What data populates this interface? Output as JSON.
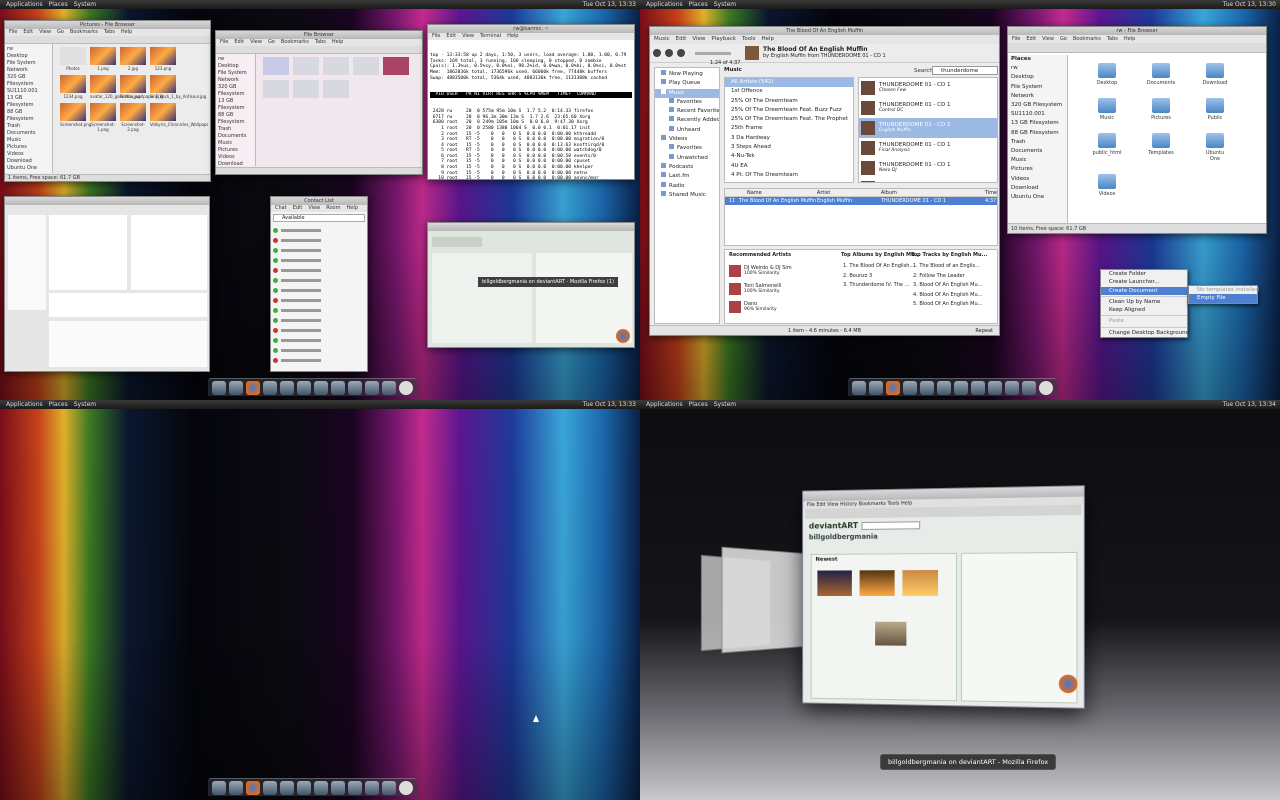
{
  "panel": {
    "applications": "Applications",
    "places": "Places",
    "system": "System",
    "clock_q1": "Tue Oct 13, 13:33",
    "clock_q2": "Tue Oct 13, 13:30",
    "clock_q3": "Tue Oct 13, 13:33",
    "clock_q4": "Tue Oct 13, 13:34"
  },
  "q1": {
    "pictures_title": "Pictures - File Browser",
    "pictures_files": [
      "Photos",
      "1.png",
      "2.jpg",
      "123.png",
      "1234.png",
      "avatar_120_galactica.jpg",
      "Firefox_wallpaper.png",
      "GnT_Pack_1_by_Antisoul.jpg",
      "Screenshot.png",
      "Screenshot-1.png",
      "Screenshot-2.png",
      "Valkyria_Chronicles_Wallpaper_by..."
    ],
    "pictures_status": "1 items, Free space: 61.7 GB",
    "term_title": "rw@karmic: ~",
    "term_menu": [
      "File",
      "Edit",
      "View",
      "Terminal",
      "Help"
    ],
    "term_lines": [
      "top - 13:33:58 up 2 days, 1:50, 3 users, load average: 1.00, 1.00, 0.79",
      "Tasks: 169 total, 3 running, 166 sleeping, 0 stopped, 0 zombie",
      "Cpu(s): 1.3%us, 0.5%sy, 0.0%ni, 98.2%id, 0.0%wa, 0.0%hi, 0.0%si, 0.0%st",
      "Mem:  1862836k total, 1736596k used, 66060k free, 77448k buffers",
      "Swap: 4883500k total, 5364k used, 4883136k free, 1131308k cached"
    ],
    "term_header": "  PID USER   PR NI VIRT RES SHR S %CPU %MEM   TIME+  COMMAND",
    "term_procs": [
      " 2428 rw     20  0 575m 95m 10m S  1.7 5.2  0:14.33 firefox",
      " 6717 rw     20  0 96.3m 30m 13m S  1.7 2.6  23:65.60 Xorg",
      " 6300 root   20  0 249m 105m 10m S  0.0 6.0  9:47.30 Xorg",
      "    1 root   20  0 2580 1380 1064 S  0.0 0.1  0:01.17 init",
      "    2 root   15 -5    0   0   0 S  0.0 0.0  0:00.00 kthreadd",
      "    3 root   RT -5    0   0   0 S  0.0 0.0  0:00.00 migration/0",
      "    4 root   15 -5    0   0   0 S  0.0 0.0  0:13.63 ksoftirqd/0",
      "    5 root   RT -5    0   0   0 S  0.0 0.0  0:00.00 watchdog/0",
      "    6 root   15 -5    0   0   0 S  0.0 0.0  0:00.58 events/0",
      "    7 root   15 -5    0   0   0 S  0.0 0.0  0:00.00 cpuset",
      "    8 root   15 -5    0   0   0 S  0.0 0.0  0:00.00 khelper",
      "    9 root   15 -5    0   0   0 S  0.0 0.0  0:00.00 netns",
      "   10 root   15 -5    0   0   0 S  0.0 0.0  0:00.00 async/mgr",
      "   11 root   15 -5    0   0   0 S  0.0 0.0  0:00.00 kintegrityd/0",
      "   12 root   15 -5    0   0   0 S  0.0 0.0  0:00.77 kblockd/0",
      "   13 root   15 -5    0   0   0 S  0.0 0.0  2:02.72 kacpid",
      "   14 root   15 -5    0   0   0 S  0.0 0.0  0:04.56 kacpi_notify"
    ],
    "contacts_title": "Contact List",
    "contacts_status": "Available",
    "firefox_tooltip": "billgoldbergmania on deviantART - Mozilla Firefox (1)"
  },
  "q2": {
    "rb_title": "The Blood Of An English Muffin",
    "rb_menu": [
      "Music",
      "Edit",
      "View",
      "Playback",
      "Tools",
      "Help"
    ],
    "rb_now_title": "The Blood Of An English Muffin",
    "rb_now_by": "by English Muffin from THUNDERDOME 01 - CD 1",
    "rb_time": "1:24 of 4:37",
    "rb_search_label": "Search:",
    "rb_search_value": "thunderdome",
    "rb_sources": [
      "Now Playing",
      "Play Queue",
      "Music",
      "Favorites",
      "Recent Favorites",
      "Recently Added",
      "Unheard",
      "Videos",
      "Favorites",
      "Unwatched",
      "Podcasts",
      "Last.fm",
      "Radio",
      "Shared Music"
    ],
    "rb_artists_header": "Music",
    "rb_artists": [
      "All Artists (542)",
      "1st Offence",
      "25% Of The Dreemteam",
      "25% Of The Dreemteam Feat. Buzz Fuzz",
      "25% Of The Dreemteam Feat. The Prophet",
      "25th Frame",
      "3 Da Hardway",
      "3 Steps Ahead",
      "4-Nu-Tek",
      "4U EA",
      "4 Pt. Of The Dreemteam"
    ],
    "rb_albums": [
      {
        "title": "THUNDERDOME 01 - CD 1",
        "artist": "Chosen Few"
      },
      {
        "title": "THUNDERDOME 01 - CD 1",
        "artist": "Control DC"
      },
      {
        "title": "THUNDERDOME 01 - CD 1",
        "artist": "English Muffin"
      },
      {
        "title": "THUNDERDOME 01 - CD 1",
        "artist": "Final Analysis"
      },
      {
        "title": "THUNDERDOME 01 - CD 1",
        "artist": "Neko DJ"
      },
      {
        "title": "THUNDERDOME 01 - CD 1",
        "artist": ""
      }
    ],
    "rb_cols": [
      "Name",
      "Artist",
      "Album",
      "Time"
    ],
    "rb_track": {
      "num": "11",
      "name": "The Blood Of An English Muffin",
      "artist": "English Muffin",
      "album": "THUNDERDOME 01 - CD 1",
      "time": "4:37"
    },
    "rb_rec_artists_h": "Recommended Artists",
    "rb_rec_artists": [
      {
        "name": "DJ Weirdo & DJ Sim",
        "sim": "100% Similarity"
      },
      {
        "name": "Toni Salmonelli",
        "sim": "100% Similarity"
      },
      {
        "name": "Dano",
        "sim": "96% Similarity"
      }
    ],
    "rb_top_albums_h": "Top Albums by English Mu...",
    "rb_top_albums": [
      "1. The Blood Of An English...",
      "2. Bounzz 3",
      "3. Thunderdome IV: The ..."
    ],
    "rb_top_tracks_h": "Top Tracks by English Mu...",
    "rb_top_tracks": [
      "1. The Blood of an Englis...",
      "2. Follow The Leader",
      "3. Blood Of An English Mu...",
      "4. Blood Of An English Mu...",
      "5. Blood Of An English Mu..."
    ],
    "rb_status": "1 item - 4.6 minutes - 6.4 MB",
    "rb_repeat": "Repeat",
    "fb_title": "rw - File Browser",
    "fb_menu": [
      "File",
      "Edit",
      "View",
      "Go",
      "Bookmarks",
      "Tabs",
      "Help"
    ],
    "fb_places_h": "Places",
    "fb_places": [
      "rw",
      "Desktop",
      "File System",
      "Network",
      "320 GB Filesystem",
      "SU1110.001",
      "13 GB Filesystem",
      "88 GB Filesystem",
      "Trash",
      "Documents",
      "Music",
      "Pictures",
      "Videos",
      "Download",
      "Ubuntu One"
    ],
    "fb_items": [
      "Desktop",
      "Documents",
      "Download",
      "Music",
      "Pictures",
      "Public",
      "public_html",
      "Templates",
      "Ubuntu One",
      "Videos"
    ],
    "fb_status": "10 items, Free space: 61.7 GB",
    "ctx_items": [
      "Create Folder",
      "Create Launcher...",
      "Create Document",
      "Clean Up by Name",
      "Keep Aligned",
      "Paste",
      "Change Desktop Background"
    ],
    "ctx_sub": [
      "No templates installed",
      "Empty File"
    ]
  },
  "q4": {
    "caption": "billgoldbergmania on deviantART - Mozilla Firefox",
    "page_user": "billgoldbergmania",
    "page_section": "Newest",
    "page_brand": "deviantART"
  }
}
